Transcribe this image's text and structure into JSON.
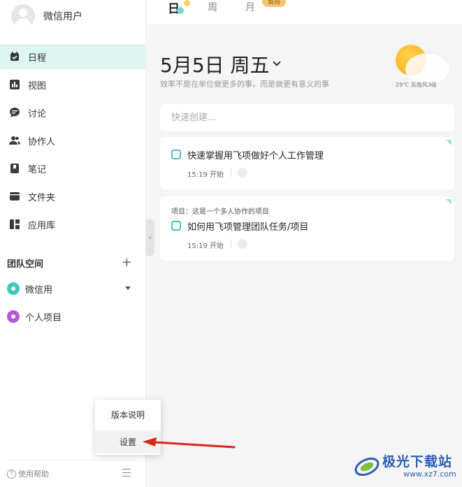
{
  "user": {
    "name": "微信用户"
  },
  "nav": [
    {
      "label": "日程",
      "icon": "calendar-icon",
      "active": true
    },
    {
      "label": "视图",
      "icon": "chart-icon"
    },
    {
      "label": "讨论",
      "icon": "chat-icon"
    },
    {
      "label": "协作人",
      "icon": "people-icon"
    },
    {
      "label": "笔记",
      "icon": "bookmark-icon"
    },
    {
      "label": "文件夹",
      "icon": "folder-icon"
    },
    {
      "label": "应用库",
      "icon": "grid-icon"
    }
  ],
  "team": {
    "title": "团队空间",
    "add": "+",
    "items": [
      {
        "label": "微信用",
        "color": "#3fc9b8"
      },
      {
        "label": "个人项目",
        "color": "#b45ad6"
      }
    ]
  },
  "footer": {
    "help_label": "使用帮助",
    "help_glyph": "?"
  },
  "collapse_glyph": "‹",
  "popup": {
    "items": [
      "版本说明",
      "设置"
    ]
  },
  "tabs": {
    "day": "日",
    "week": "周",
    "month": "月",
    "vip_badge": "会员"
  },
  "header": {
    "date": "5月5日 周五",
    "subtitle": "效率不是在单位做更多的事，而是做更有意义的事"
  },
  "weather": {
    "text": "29℃ 东南风3级"
  },
  "quick_create": {
    "placeholder": "快速创建..."
  },
  "tasks": [
    {
      "project": "",
      "title": "快速掌握用飞项做好个人工作管理",
      "time": "15:19 开始"
    },
    {
      "project": "项目：这是一个多人协作的项目",
      "title": "如何用飞项管理团队任务/项目",
      "time": "15:19 开始"
    }
  ],
  "watermark": {
    "title": "极光下载站",
    "url": "www.xz7.com"
  },
  "colors": {
    "accent": "#3fc9b8",
    "active_bg": "#ddf6f2",
    "arrow": "#d9261c"
  }
}
